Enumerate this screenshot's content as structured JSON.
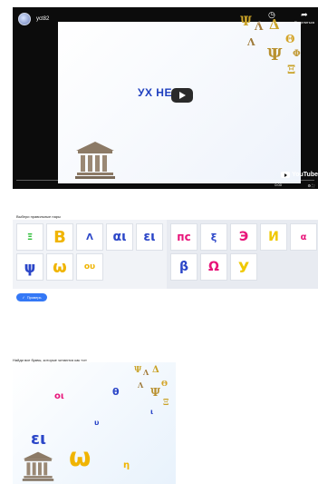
{
  "video": {
    "channel_name": "yct82",
    "slide_title": "УХ НЕ",
    "top_actions": [
      {
        "icon": "clock-icon",
        "label": "Смотреть позже"
      },
      {
        "icon": "share-icon",
        "label": "Поделиться"
      }
    ],
    "time": "0:00",
    "youtube_label": "YouTube",
    "greek_letters": [
      "Ψ",
      "Λ",
      "Δ",
      "Θ",
      "Ψ",
      "Λ",
      "Ξ",
      "Φ"
    ]
  },
  "exercise1": {
    "instruction": "Выбери правильные пары",
    "left_tiles": [
      {
        "text": "Ξ",
        "color": "#2fbf3a"
      },
      {
        "text": "B",
        "color": "#f0b400"
      },
      {
        "text": "Λ",
        "color": "#2b46c8"
      },
      {
        "text": "αι",
        "color": "#2b46c8"
      },
      {
        "text": "ει",
        "color": "#2b46c8"
      },
      {
        "text": "ψ",
        "color": "#2b46c8"
      },
      {
        "text": "ω",
        "color": "#f0b400"
      },
      {
        "text": "ου",
        "color": "#f0b400"
      }
    ],
    "right_tiles": [
      {
        "text": "пс",
        "color": "#e8157a"
      },
      {
        "text": "ξ",
        "color": "#2b46c8"
      },
      {
        "text": "Э",
        "color": "#e8157a"
      },
      {
        "text": "И",
        "color": "#f0c800"
      },
      {
        "text": "α",
        "color": "#e8157a"
      },
      {
        "text": "β",
        "color": "#2b46c8"
      },
      {
        "text": "Ω",
        "color": "#e8157a"
      },
      {
        "text": "У",
        "color": "#f0c800"
      }
    ],
    "check_label": "Проверь"
  },
  "exercise2": {
    "instruction": "Найди все буквы, которые читаются как «и»",
    "letters": [
      {
        "text": "οι",
        "color": "#e8157a"
      },
      {
        "text": "θ",
        "color": "#2b46c8"
      },
      {
        "text": "υ",
        "color": "#2b46c8"
      },
      {
        "text": "ι",
        "color": "#2b46c8"
      },
      {
        "text": "ει",
        "color": "#2b46c8"
      },
      {
        "text": "ω",
        "color": "#f0b400"
      },
      {
        "text": "η",
        "color": "#f0b400"
      }
    ],
    "greek_letters": [
      "Ψ",
      "Λ",
      "Δ",
      "Θ",
      "Ψ",
      "Λ",
      "Ξ"
    ]
  },
  "colors": {
    "accent": "#3478f6",
    "player_bg": "#0c0c0c",
    "gold": "#c9a227"
  }
}
